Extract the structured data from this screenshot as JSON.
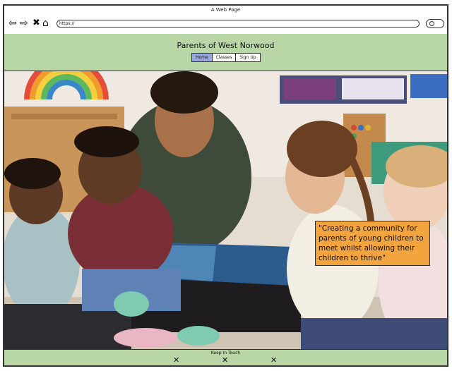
{
  "browser": {
    "window_title": "A Web Page",
    "url": "https://",
    "back_icon": "arrow-left-icon",
    "forward_icon": "arrow-right-icon",
    "close_icon": "close-x-icon",
    "home_icon": "home-icon",
    "search_icon": "search-icon"
  },
  "header": {
    "title": "Parents of West Norwood",
    "nav": [
      {
        "label": "Home",
        "active": true
      },
      {
        "label": "Classes",
        "active": false
      },
      {
        "label": "Sign Up",
        "active": false
      }
    ],
    "color": "#b9d6a6",
    "active_color": "#9aa6e0"
  },
  "hero": {
    "image": "adult-reading-book-to-toddlers-photo",
    "quote": "\"Creating a community for parents of young children to meet whilst allowing their children to thrive\"",
    "quote_color": "#f2a43f"
  },
  "footer": {
    "title": "Keep In Touch",
    "icons": [
      "social-x-icon",
      "social-x-icon",
      "social-x-icon"
    ]
  }
}
